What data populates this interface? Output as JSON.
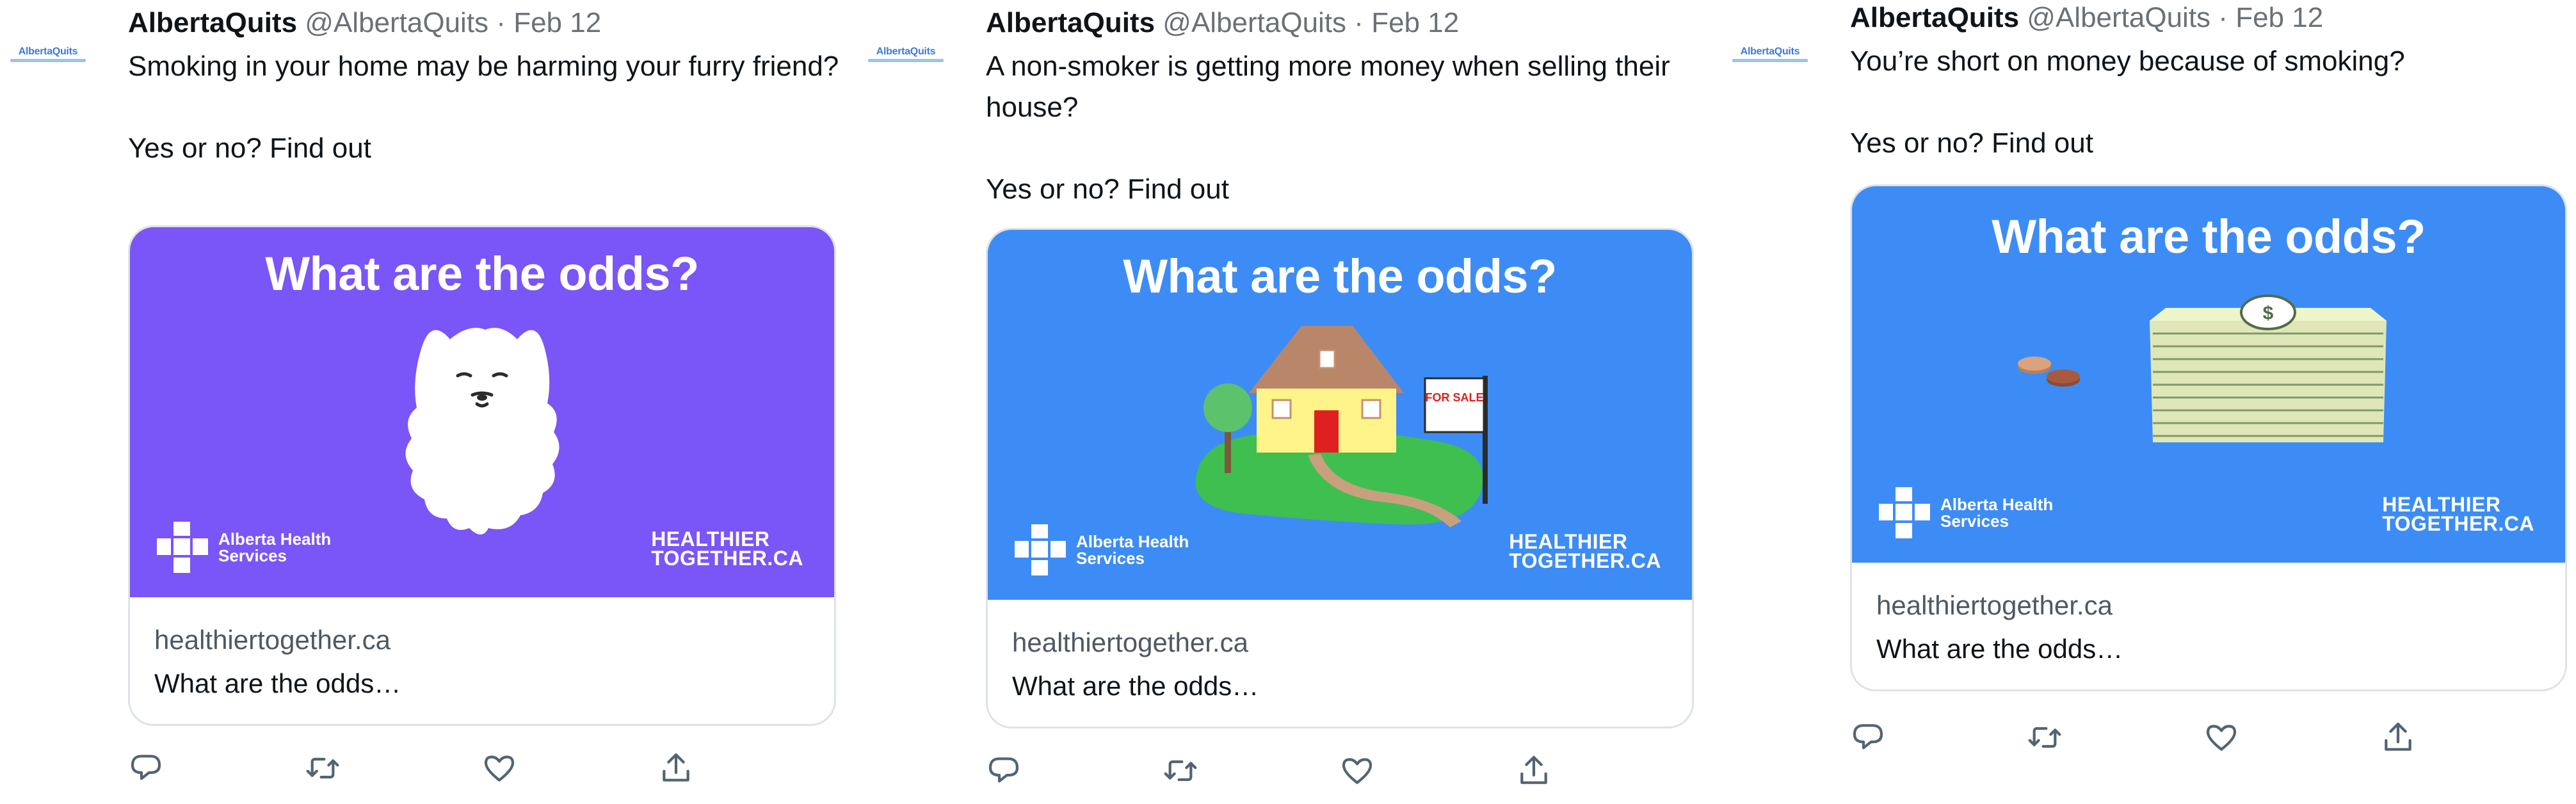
{
  "tweets": [
    {
      "logo_text": "AlbertaQuits",
      "author_name": "AlbertaQuits",
      "handle": "@AlbertaQuits",
      "separator": "·",
      "date": "Feb 12",
      "text_line1": "Smoking in your home may be harming your furry friend?",
      "text_line2": "Yes or no? Find out",
      "card_headline": "What are the odds?",
      "card_bg_color": "#7a55f7",
      "illustration": "dog-illustration",
      "ahs_logo_text": "Alberta Health\nServices",
      "ht_logo_line1": "HEALTHIER",
      "ht_logo_line2": "TOGETHER.CA",
      "card_domain": "healthiertogether.ca",
      "card_title": "What are the odds…"
    },
    {
      "logo_text": "AlbertaQuits",
      "author_name": "AlbertaQuits",
      "handle": "@AlbertaQuits",
      "separator": "·",
      "date": "Feb 12",
      "text_line1": "A non-smoker is getting more money when selling their house?",
      "text_line2": "Yes or no? Find out",
      "card_headline": "What are the odds?",
      "card_bg_color": "#3d8cf5",
      "illustration": "house-illustration",
      "for_sale_text": "FOR SALE",
      "ahs_logo_text": "Alberta Health\nServices",
      "ht_logo_line1": "HEALTHIER",
      "ht_logo_line2": "TOGETHER.CA",
      "card_domain": "healthiertogether.ca",
      "card_title": "What are the odds…"
    },
    {
      "logo_text": "AlbertaQuits",
      "author_name": "AlbertaQuits",
      "handle": "@AlbertaQuits",
      "separator": "·",
      "date": "Feb 12",
      "text_line1": "You’re short on money because of smoking?",
      "text_line2": "Yes or no? Find out",
      "card_headline": "What are the odds?",
      "card_bg_color": "#3d8cf5",
      "illustration": "money-illustration",
      "ahs_logo_text": "Alberta Health\nServices",
      "ht_logo_line1": "HEALTHIER",
      "ht_logo_line2": "TOGETHER.CA",
      "card_domain": "healthiertogether.ca",
      "card_title": "What are the odds…"
    }
  ],
  "actions": [
    "reply-icon",
    "retweet-icon",
    "like-icon",
    "share-icon"
  ],
  "colors": {
    "text_primary": "#0f1419",
    "text_secondary": "#6b7176",
    "card_border": "#dde3e8",
    "icon_color": "#536471"
  }
}
